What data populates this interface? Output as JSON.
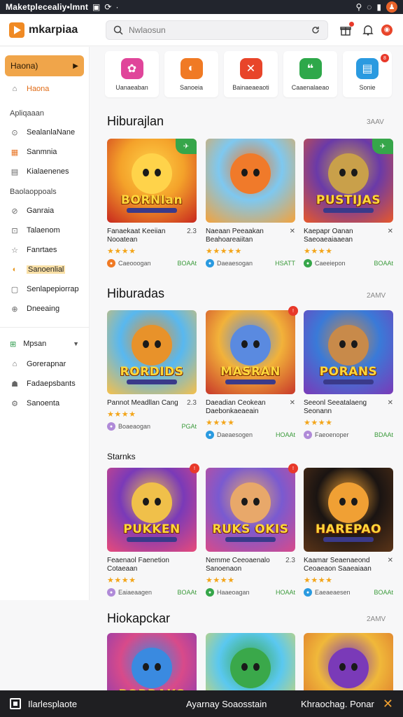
{
  "status_bar": {
    "title": "Maketplecealiy•lmnt",
    "icons": [
      "▣",
      "⟳",
      "·"
    ],
    "right_icons": [
      "⚲",
      "◌",
      "▮"
    ]
  },
  "header": {
    "logo": "mkarpiaa",
    "search_placeholder": "Nwlaosun"
  },
  "sidebar": {
    "active": "Haona)",
    "home": "Haona",
    "section1": "Apliqaaan",
    "items1": [
      "SealanlaNane",
      "Sanmnia",
      "Kialaenenes"
    ],
    "section2": "Baolaoppoals",
    "items2": [
      "Ganraia",
      "Talaenom",
      "Fanrtaes",
      "Sanoenlial",
      "Senlapepiorrap",
      "Dneeaing"
    ],
    "group": "Mpsan",
    "items3": [
      "Gorerapnar",
      "Fadaepsbants",
      "Sanoenta"
    ]
  },
  "categories": [
    {
      "label": "Uanaeaban",
      "color": "#e0459a",
      "glyph": "✿"
    },
    {
      "label": "Sanoeia",
      "color": "#f07a24",
      "glyph": "◐"
    },
    {
      "label": "Bainaeaeaoti",
      "color": "#e8452a",
      "glyph": "✕"
    },
    {
      "label": "Caaenalaeao",
      "color": "#2ea84a",
      "glyph": "❝"
    },
    {
      "label": "Sonie",
      "color": "#2a9ae0",
      "glyph": "▤",
      "badge": "8"
    }
  ],
  "sections": [
    {
      "title": "Hiburajlan",
      "more": "3AAV"
    },
    {
      "title": "Hiburadas",
      "more": "2AMV"
    },
    {
      "title": "Starnks",
      "more": ""
    },
    {
      "title": "Hiokapckar",
      "more": "2AMV"
    }
  ],
  "cards": [
    {
      "title": "Fanaekaat Keeiian Nooatean",
      "rank": "2.3",
      "stars": "★★★★",
      "dev": "Caeooogan",
      "price": "BOAAt",
      "art": "BORNIan",
      "tag": "",
      "dev_color": "#f07a24"
    },
    {
      "title": "Naeaan Peeaakan Beahoareaiitan",
      "rank": "✕",
      "stars": "★★★★★",
      "dev": "Daeaesogan",
      "price": "HSATT",
      "art": "",
      "tag": "",
      "dev_color": "#2a9ae0"
    },
    {
      "title": "Kaepapr Oanan Saeoaeaiaaean",
      "rank": "✕",
      "stars": "★★★★",
      "dev": "Caeeiepon",
      "price": "BOAAt",
      "art": "PUSTIJAS",
      "tag": "",
      "dev_color": "#36a64a"
    },
    {
      "title": "Pannot Meadllan Cang",
      "rank": "2.3",
      "stars": "★★★★",
      "dev": "Boaeaogan",
      "price": "PGAt",
      "art": "RORDIDS",
      "tag": "",
      "dev_color": "#b08ad8"
    },
    {
      "title": "Daeadian Ceokean Daebonkaeaeain",
      "rank": "✕",
      "stars": "★★★★",
      "dev": "Daeaesogen",
      "price": "HOAAt",
      "art": "MASRAN",
      "tag": "",
      "dev_color": "#2a9ae0"
    },
    {
      "title": "Seeonl Seeatalaeng Seonann",
      "rank": "✕",
      "stars": "★★★★",
      "dev": "Faeoenoper",
      "price": "BDAAt",
      "art": "PORANS",
      "tag": "",
      "dev_color": "#b08ad8"
    },
    {
      "title": "Feaenaol Faenetion Cotaeaan",
      "rank": "",
      "stars": "★★★★",
      "dev": "Eaiaeaagen",
      "price": "BOAAt",
      "art": "PUKKEN",
      "tag": "",
      "dev_color": "#b08ad8"
    },
    {
      "title": "Nemme Ceeoaenalo Sanoenaon",
      "rank": "2.3",
      "stars": "★★★★",
      "dev": "Haaeoagan",
      "price": "HOAAt",
      "art": "RUKS OKIS",
      "tag": "",
      "dev_color": "#36a64a"
    },
    {
      "title": "Kaamar Seaenaeond Ceoaeaon Saaeaiaan",
      "rank": "✕",
      "stars": "★★★★",
      "dev": "Eaeaeaesen",
      "price": "BOAAt",
      "art": "HAREPAO",
      "tag": "",
      "dev_color": "#2a9ae0"
    },
    {
      "title": "",
      "art": "PORRAKS"
    },
    {
      "title": "",
      "art": ""
    },
    {
      "title": "",
      "art": ""
    }
  ],
  "bottom_bar": {
    "left": "Ilarlesplaote",
    "mid": "Ayarnay Soaosstain",
    "right": "Khraochag. Ponar",
    "close": "✕"
  },
  "colors": {
    "accent": "#f0a54a",
    "brand": "#f08a24",
    "star": "#f3a51a"
  }
}
